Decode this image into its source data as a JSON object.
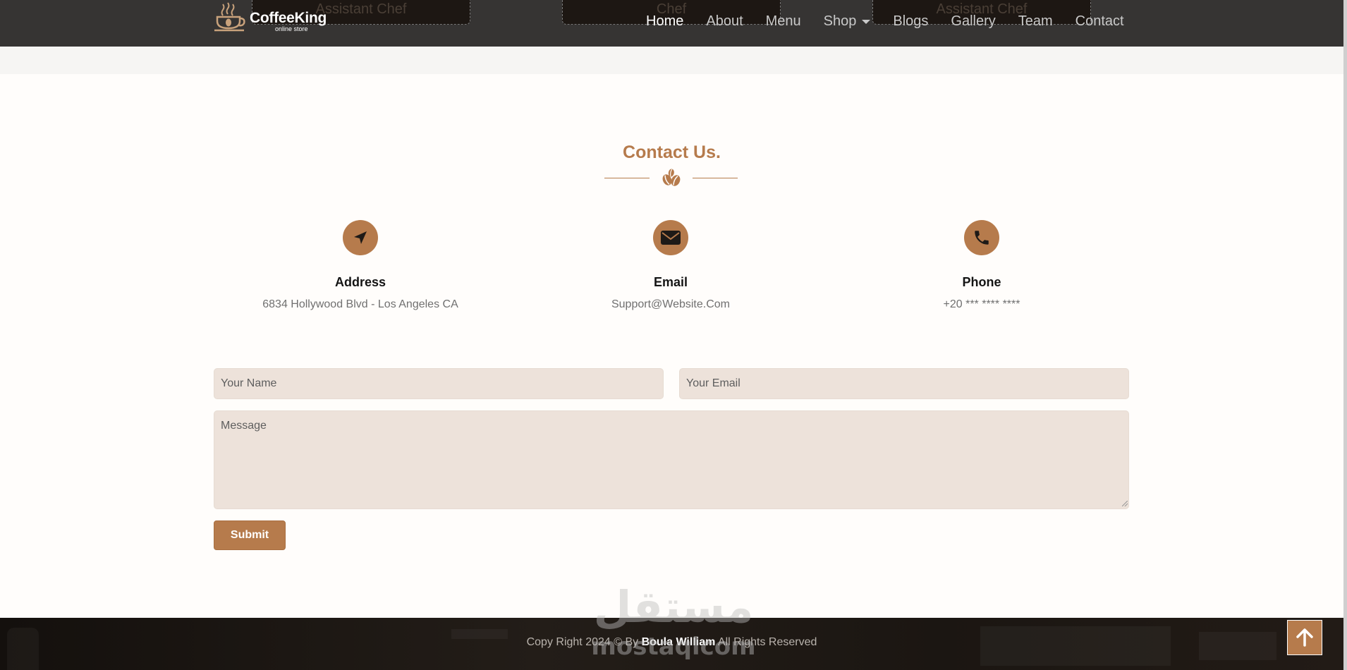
{
  "navbar": {
    "brand_name": "CoffeeKing",
    "brand_tagline": "online store",
    "peek_cards": [
      "Assistant Chef",
      "Chef",
      "Assistant Chef"
    ],
    "links": [
      {
        "label": "Home",
        "active": true
      },
      {
        "label": "About"
      },
      {
        "label": "Menu"
      },
      {
        "label": "Shop",
        "has_dropdown": true
      },
      {
        "label": "Blogs"
      },
      {
        "label": "Gallery"
      },
      {
        "label": "Team"
      },
      {
        "label": "Contact"
      }
    ]
  },
  "contact": {
    "title": "Contact Us.",
    "divider_icon": "coffee-beans-icon",
    "info": [
      {
        "icon": "location-arrow-icon",
        "title": "Address",
        "value": "6834 Hollywood Blvd - Los Angeles CA"
      },
      {
        "icon": "envelope-icon",
        "title": "Email",
        "value": "Support@Website.Com"
      },
      {
        "icon": "phone-icon",
        "title": "Phone",
        "value": "+20 *** **** ****"
      }
    ],
    "form": {
      "name_placeholder": "Your Name",
      "email_placeholder": "Your Email",
      "message_placeholder": "Message",
      "submit_label": "Submit"
    }
  },
  "watermark": {
    "text": "مستقل",
    "latin": "mostaqlcom"
  },
  "footer": {
    "copyright_prefix": "Copy Right 2024 © By ",
    "author": "Boula William",
    "copyright_suffix": " All Rights Reserved",
    "to_top_icon": "arrow-up-icon"
  },
  "colors": {
    "accent": "#b67b4c",
    "navbar_bg": "#363433",
    "input_bg": "#ede2da",
    "footer_bg": "#1b1612"
  }
}
